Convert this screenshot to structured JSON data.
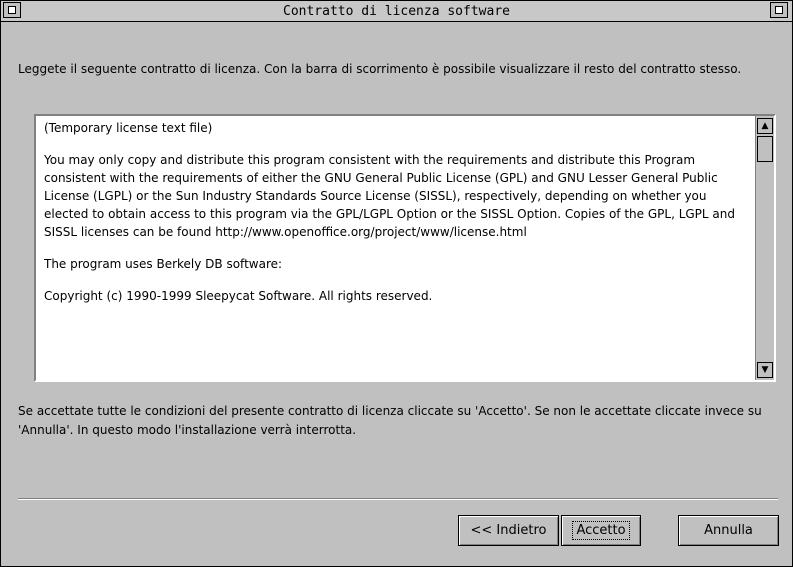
{
  "window": {
    "title": "Contratto di licenza software"
  },
  "intro": {
    "text": "Leggete il seguente contratto di licenza. Con la barra di scorrimento è possibile visualizzare il resto del contratto stesso."
  },
  "license": {
    "paragraphs": [
      "(Temporary license text file)",
      "You may only copy and distribute this program consistent with the requirements and distribute this Program consistent with the requirements of either the GNU General Public License (GPL) and GNU Lesser General Public License (LGPL) or the Sun Industry Standards Source License (SISSL), respectively, depending on whether you elected to obtain access to this program via the GPL/LGPL Option or the SISSL Option. Copies of the GPL, LGPL and SISSL licenses can be found http://www.openoffice.org/project/www/license.html",
      "The program uses Berkely DB software:",
      "Copyright (c) 1990-1999 Sleepycat Software.  All rights reserved."
    ]
  },
  "outro": {
    "text": "Se accettate tutte le condizioni del presente contratto di licenza cliccate su 'Accetto'. Se non le accettate cliccate invece su 'Annulla'. In questo modo l'installazione verrà interrotta."
  },
  "buttons": {
    "back": "<< Indietro",
    "accept": "Accetto",
    "cancel": "Annulla"
  }
}
